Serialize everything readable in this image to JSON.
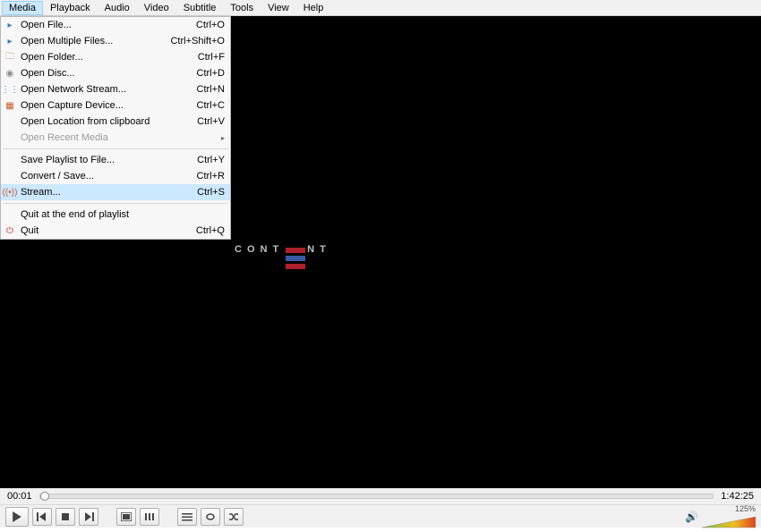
{
  "menubar": [
    "Media",
    "Playback",
    "Audio",
    "Video",
    "Subtitle",
    "Tools",
    "View",
    "Help"
  ],
  "dropdown": {
    "groups": [
      [
        {
          "label": "Open File...",
          "shortcut": "Ctrl+O",
          "icon": "▸",
          "iconColor": "#3a7ac8"
        },
        {
          "label": "Open Multiple Files...",
          "shortcut": "Ctrl+Shift+O",
          "icon": "▸",
          "iconColor": "#3a7ac8"
        },
        {
          "label": "Open Folder...",
          "shortcut": "Ctrl+F",
          "icon": "🗀",
          "iconColor": "#b8a26b"
        },
        {
          "label": "Open Disc...",
          "shortcut": "Ctrl+D",
          "icon": "◉",
          "iconColor": "#8a8a8a"
        },
        {
          "label": "Open Network Stream...",
          "shortcut": "Ctrl+N",
          "icon": "⋮⋮",
          "iconColor": "#3a7ac8"
        },
        {
          "label": "Open Capture Device...",
          "shortcut": "Ctrl+C",
          "icon": "▦",
          "iconColor": "#cc5a2a"
        },
        {
          "label": "Open Location from clipboard",
          "shortcut": "Ctrl+V",
          "icon": ""
        },
        {
          "label": "Open Recent Media",
          "shortcut": "",
          "icon": "",
          "disabled": true,
          "submenu": true
        }
      ],
      [
        {
          "label": "Save Playlist to File...",
          "shortcut": "Ctrl+Y",
          "icon": ""
        },
        {
          "label": "Convert / Save...",
          "shortcut": "Ctrl+R",
          "icon": ""
        },
        {
          "label": "Stream...",
          "shortcut": "Ctrl+S",
          "icon": "((•))",
          "iconColor": "#cc5a2a",
          "hovered": true
        }
      ],
      [
        {
          "label": "Quit at the end of playlist",
          "shortcut": "",
          "icon": ""
        },
        {
          "label": "Quit",
          "shortcut": "Ctrl+Q",
          "icon": "⏻",
          "iconColor": "#c62828"
        }
      ]
    ]
  },
  "time": {
    "current": "00:01",
    "total": "1:42:25"
  },
  "volume": {
    "label": "125%"
  },
  "logo": {
    "text_before": "CONT",
    "text_after": "NT",
    "bars": [
      "#b0202a",
      "#3a5aa8",
      "#b0202a"
    ]
  }
}
